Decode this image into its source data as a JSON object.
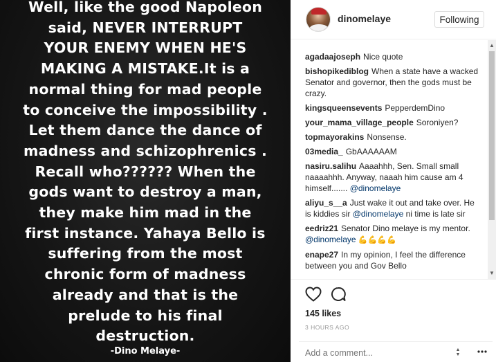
{
  "image": {
    "quote": "Well, like the good Napoleon said, NEVER INTERRUPT YOUR ENEMY WHEN HE'S MAKING A MISTAKE.It is a normal thing for mad people to conceive the impossibility . Let them dance the dance of madness and schizophrenics . Recall who?????? When the gods want to destroy a man, they make him mad in the first instance. Yahaya Bello is suffering from the most chronic form of madness already and that is the prelude to his final destruction.",
    "quote_lines": "Well, like the good Napoleon\nsaid, NEVER INTERRUPT\nYOUR ENEMY WHEN HE'S\nMAKING A MISTAKE.It is a\nnormal thing for mad people\nto conceive the impossibility .\nLet them dance the dance of\nmadness and schizophrenics .\nRecall who?????? When the\ngods want to destroy a man,\nthey make him mad in the\nfirst instance. Yahaya Bello is\nsuffering from the most\nchronic form of madness\nalready and that is the\nprelude to his final\ndestruction.",
    "signature": "-Dino Melaye-"
  },
  "header": {
    "username": "dinomelaye",
    "follow_label": "Following"
  },
  "comments": [
    {
      "user": "agadaajoseph",
      "text": "Nice quote",
      "mention": "",
      "emoji": ""
    },
    {
      "user": "bishopikediblog",
      "text": "When a state have a wacked Senator and governor, then the gods must be crazy.",
      "mention": "",
      "emoji": ""
    },
    {
      "user": "kingsqueensevents",
      "text": "PepperdemDino",
      "mention": "",
      "emoji": ""
    },
    {
      "user": "your_mama_village_people",
      "text": "Soroniyen?",
      "mention": "",
      "emoji": ""
    },
    {
      "user": "topmayorakins",
      "text": "Nonsense.",
      "mention": "",
      "emoji": ""
    },
    {
      "user": "03media_",
      "text": "GbAAAAAAM",
      "mention": "",
      "emoji": ""
    },
    {
      "user": "nasiru.salihu",
      "text": "Aaaahhh, Sen. Small small naaaahhh. Anyway, naaah him cause am 4 himself.......",
      "mention": "@dinomelaye",
      "emoji": ""
    },
    {
      "user": "aliyu_s__a",
      "text": "Just wake it out and take over. He is kiddies sir",
      "mention": "@dinomelaye",
      "after": "ni time is late sir",
      "emoji": ""
    },
    {
      "user": "eedriz21",
      "text": "Senator Dino melaye is my mentor.",
      "mention": "@dinomelaye",
      "emoji": "💪💪💪💪"
    },
    {
      "user": "enape27",
      "text": "In my opinion, I feel the difference between you and Gov Bello",
      "mention": "",
      "emoji": ""
    }
  ],
  "actions": {
    "likes": "145 likes",
    "timestamp": "3 HOURS AGO",
    "like_icon": "heart-outline",
    "comment_icon": "speech-bubble"
  },
  "add_comment": {
    "placeholder": "Add a comment..."
  }
}
